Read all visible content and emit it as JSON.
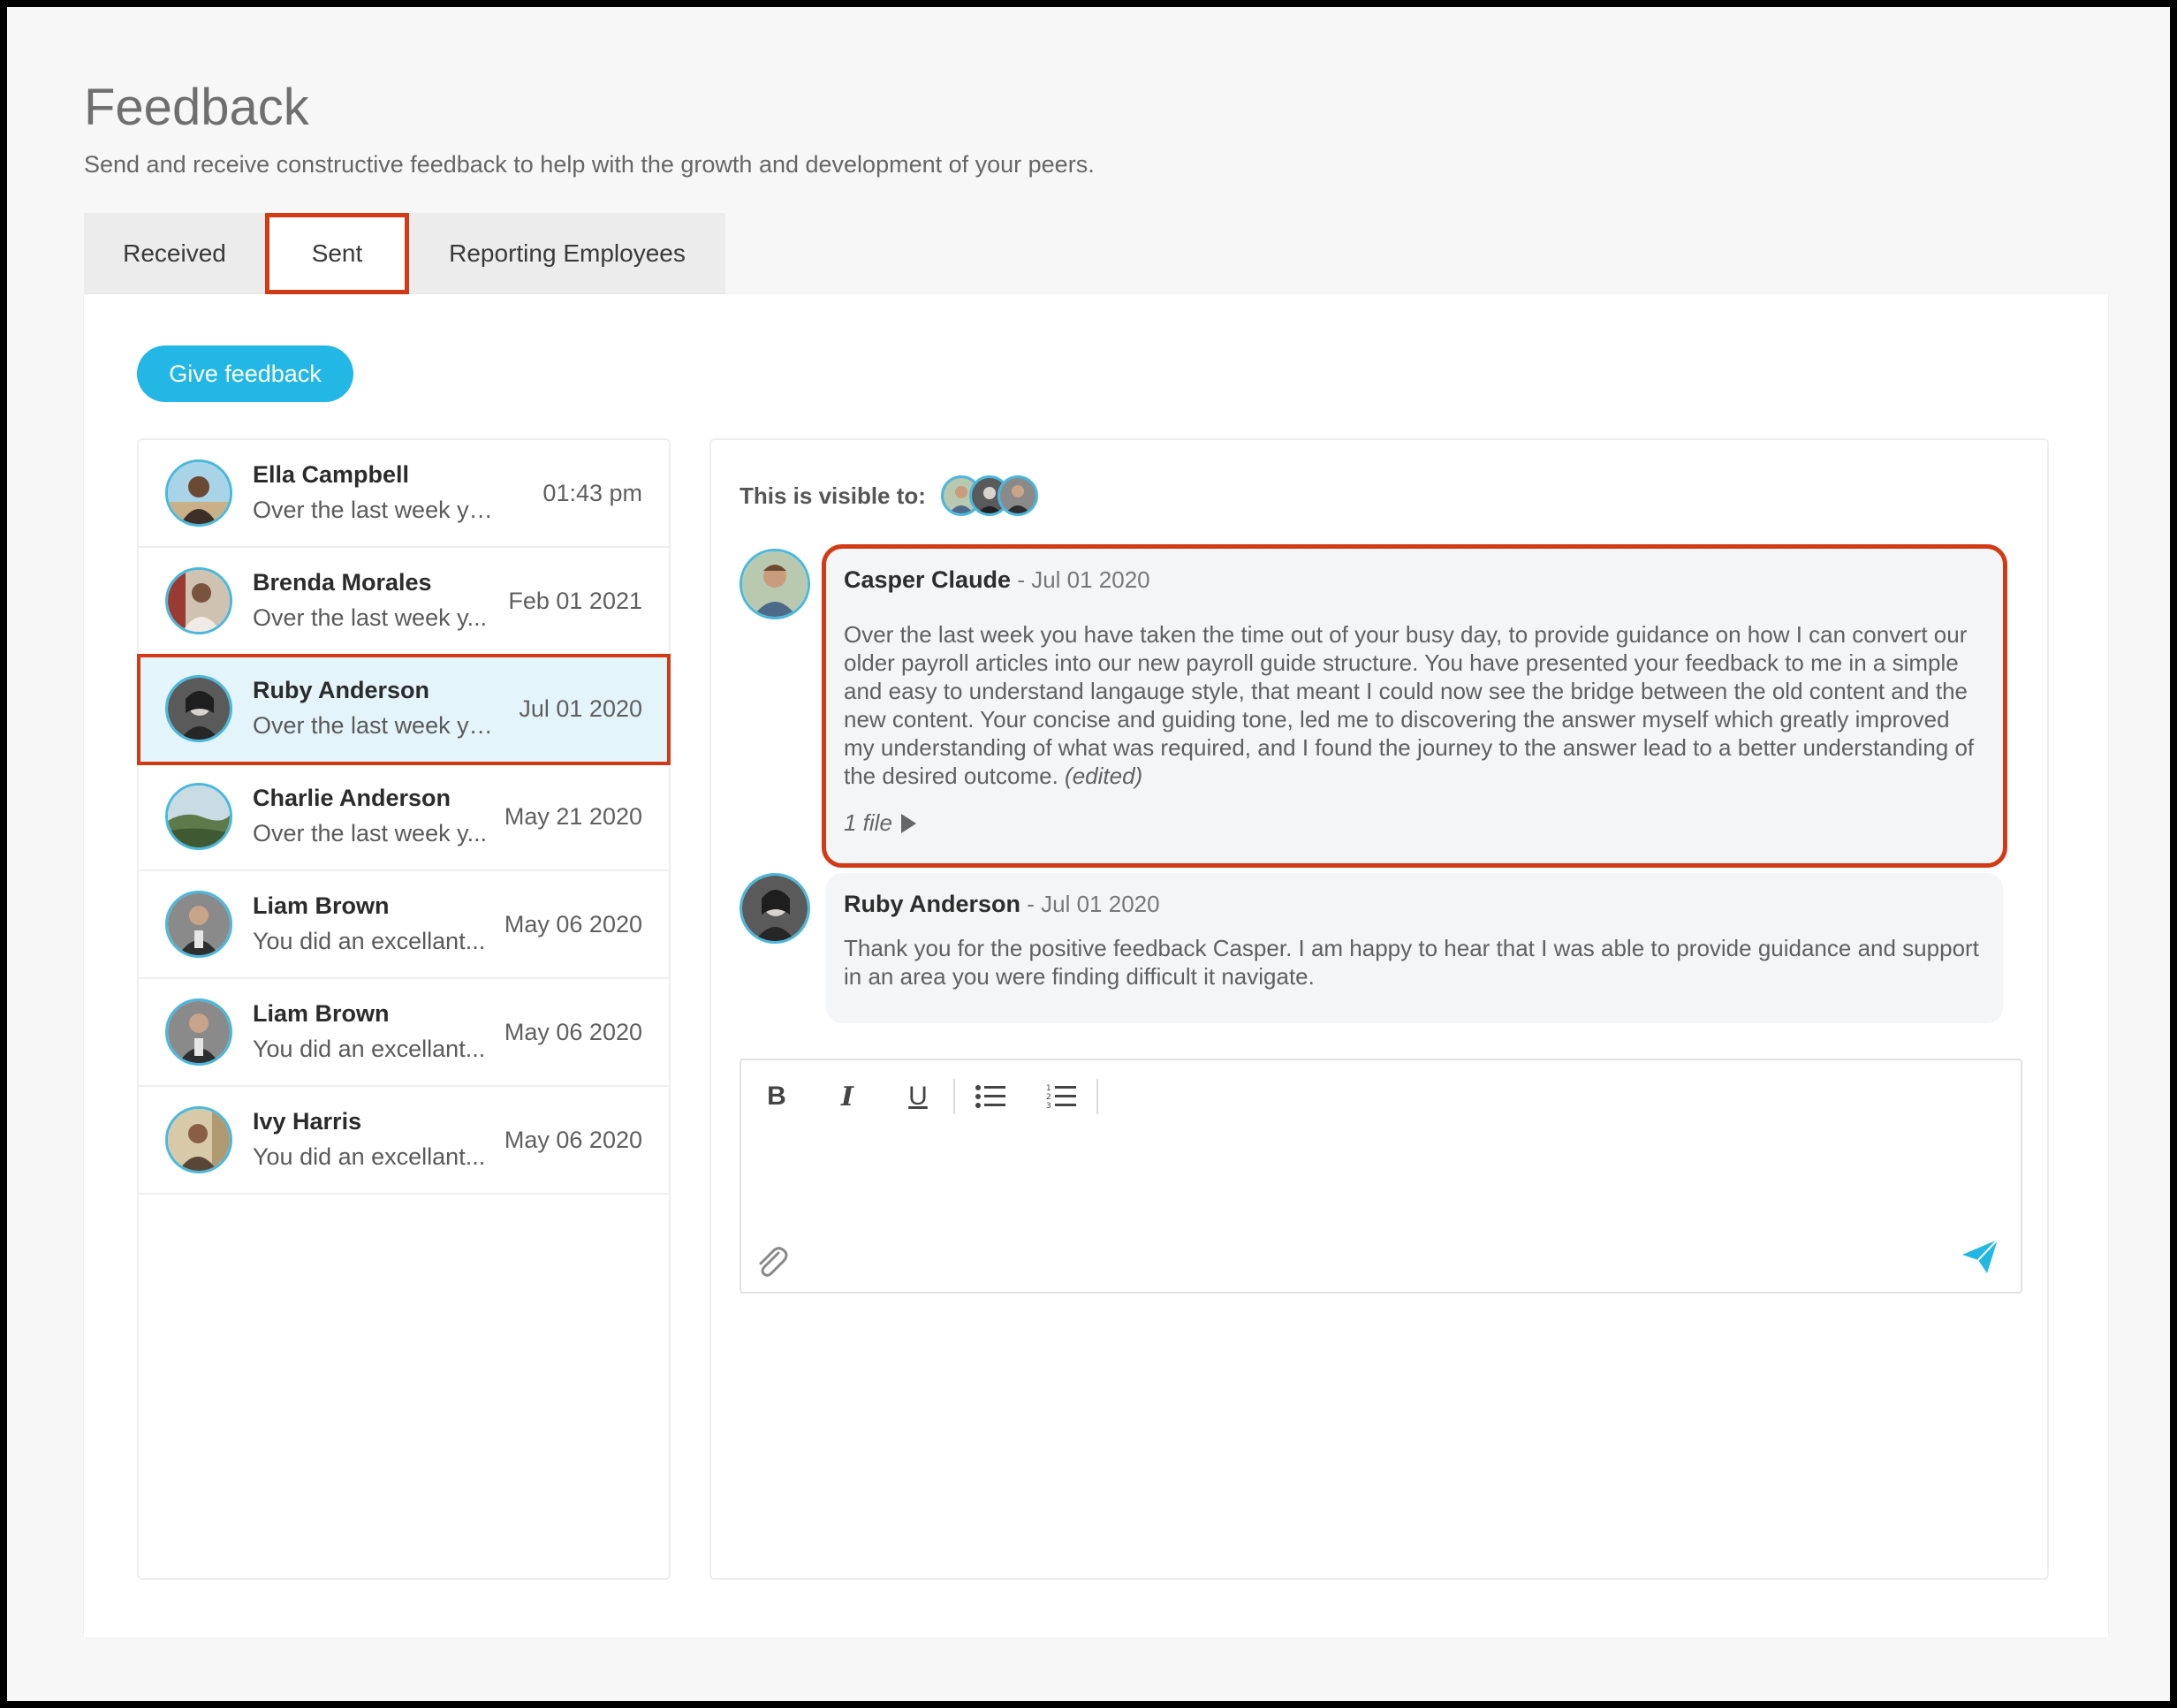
{
  "header": {
    "title": "Feedback",
    "subtitle": "Send and receive constructive feedback to help with the growth and development of your peers."
  },
  "tabs": [
    {
      "label": "Received"
    },
    {
      "label": "Sent"
    },
    {
      "label": "Reporting Employees"
    }
  ],
  "active_tab": "Sent",
  "give_feedback_label": "Give feedback",
  "list": [
    {
      "name": "Ella Campbell",
      "snippet": "Over the last week you ...",
      "date": "01:43 pm"
    },
    {
      "name": "Brenda Morales",
      "snippet": "Over the last week y...",
      "date": "Feb 01 2021"
    },
    {
      "name": "Ruby Anderson",
      "snippet": "Over the last week yo...",
      "date": "Jul 01 2020"
    },
    {
      "name": "Charlie Anderson",
      "snippet": "Over the last week y...",
      "date": "May 21 2020"
    },
    {
      "name": "Liam Brown",
      "snippet": "You did an excellant...",
      "date": "May 06 2020"
    },
    {
      "name": "Liam Brown",
      "snippet": "You did an excellant...",
      "date": "May 06 2020"
    },
    {
      "name": "Ivy Harris",
      "snippet": "You did an excellant...",
      "date": "May 06 2020"
    }
  ],
  "selected_item": "Ruby Anderson",
  "detail": {
    "visible_to_label": "This is visible to:",
    "messages": [
      {
        "author": "Casper Claude",
        "date": "- Jul 01 2020",
        "body": "Over the last week you have taken the time out of your busy day, to provide guidance on how I can convert our older payroll articles into our new payroll guide structure. You have presented your feedback to me in a simple and easy to understand langauge style, that meant I could now see the bridge between the old content and the new content. Your concise and guiding tone, led me to discovering the answer myself which greatly improved my understanding of what was required, and I found the journey to the answer lead to a better understanding of the desired outcome.",
        "edited": "(edited)",
        "files": "1 file"
      },
      {
        "author": "Ruby Anderson",
        "date": "- Jul 01 2020",
        "body": "Thank you for the positive feedback Casper. I am happy to hear that I was able to provide guidance and support in an area you were finding difficult it navigate."
      }
    ]
  },
  "editor": {
    "toolbar": {
      "bold": "B",
      "italic": "I",
      "underline": "U"
    }
  },
  "colors": {
    "accent": "#23b7e5",
    "highlight": "#d23a16",
    "selected_bg": "#e3f4fb"
  }
}
